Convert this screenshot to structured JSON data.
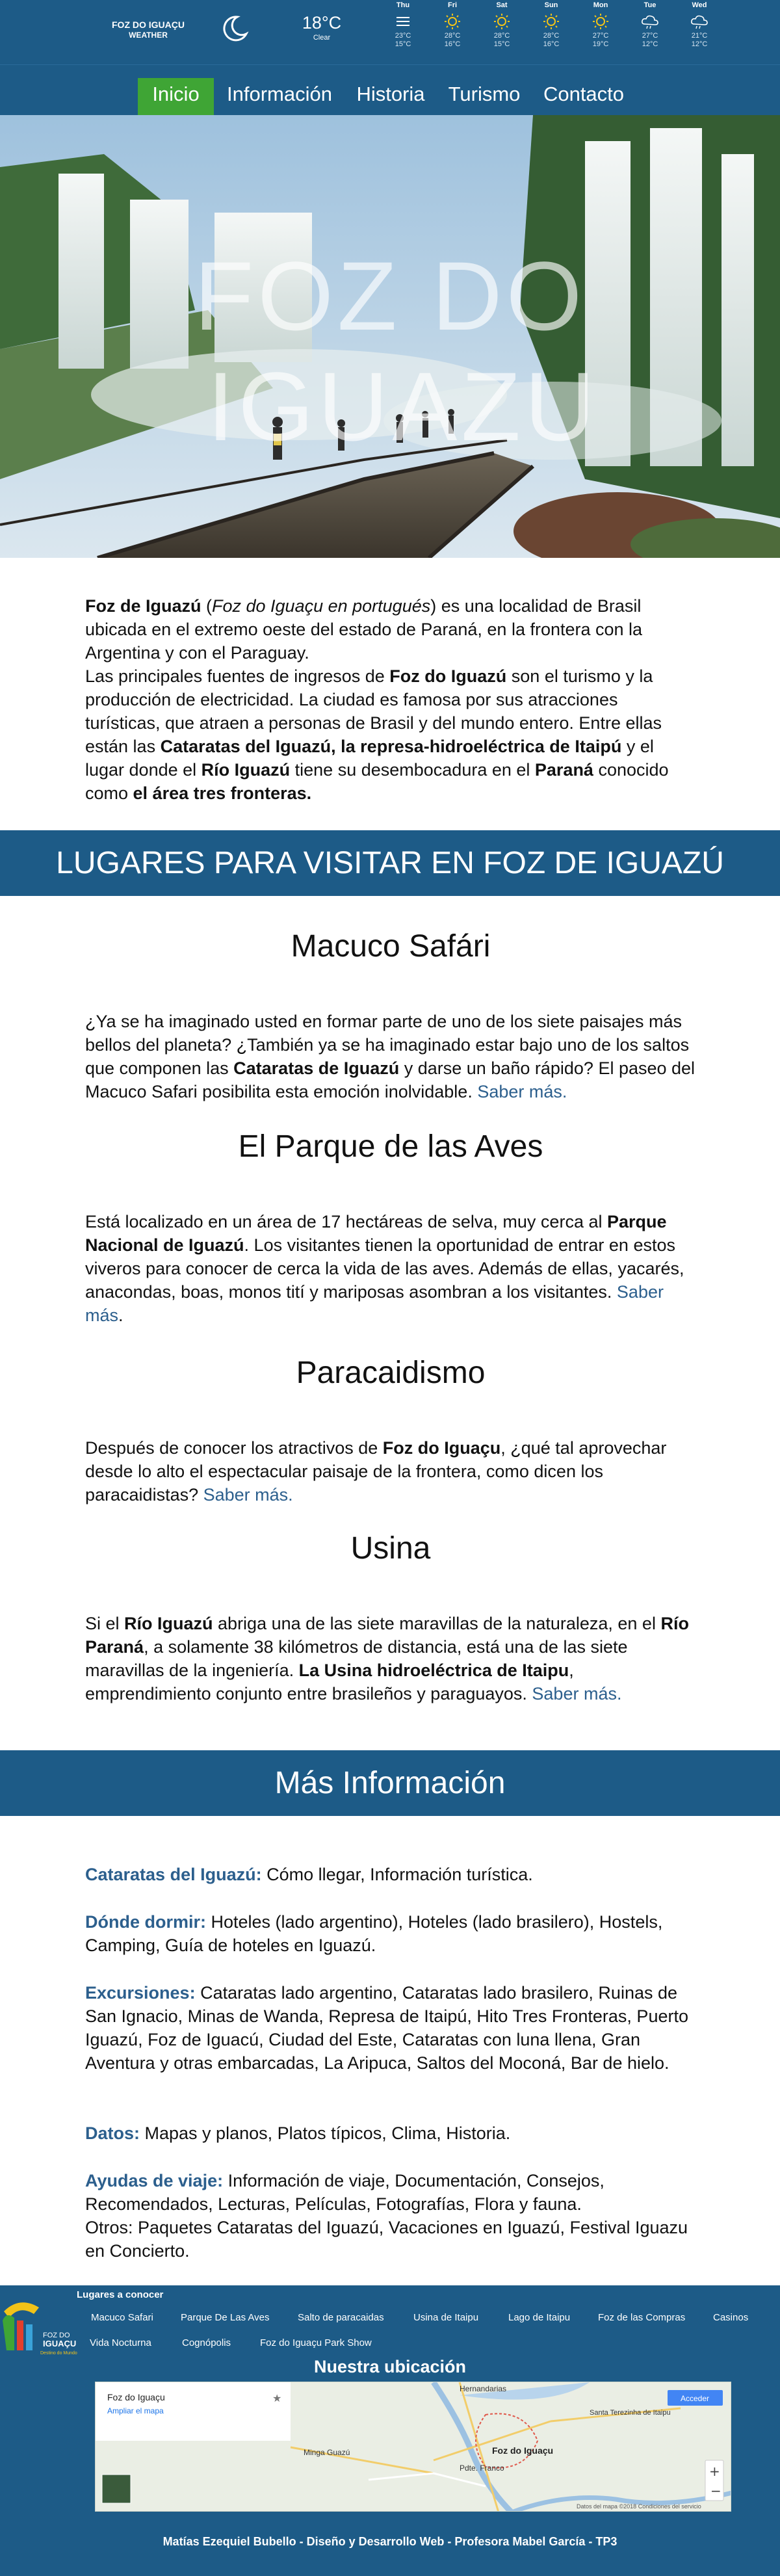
{
  "weather": {
    "location_line1": "FOZ DO IGUAÇU",
    "location_line2": "WEATHER",
    "icon": "moon-icon",
    "temp": "18°C",
    "condition": "Clear",
    "days": [
      {
        "name": "Thu",
        "icon": "menu-icon",
        "hi": "23°C",
        "lo": "15°C"
      },
      {
        "name": "Fri",
        "icon": "sun-icon",
        "hi": "28°C",
        "lo": "16°C"
      },
      {
        "name": "Sat",
        "icon": "sun-icon",
        "hi": "28°C",
        "lo": "15°C"
      },
      {
        "name": "Sun",
        "icon": "sun-icon",
        "hi": "28°C",
        "lo": "16°C"
      },
      {
        "name": "Mon",
        "icon": "sun-icon",
        "hi": "27°C",
        "lo": "19°C"
      },
      {
        "name": "Tue",
        "icon": "cloud-rain-icon",
        "hi": "27°C",
        "lo": "12°C"
      },
      {
        "name": "Wed",
        "icon": "cloud-rain-icon",
        "hi": "21°C",
        "lo": "12°C"
      }
    ]
  },
  "nav": {
    "items": [
      "Inicio",
      "Información",
      "Historia",
      "Turismo",
      "Contacto"
    ],
    "active": "Inicio",
    "active_color": "#3fa535",
    "bar_color": "#1d5b87"
  },
  "hero": {
    "title_line1": "FOZ DO",
    "title_line2": "IGUAZU"
  },
  "intro": {
    "p1_bold1": "Foz de Iguazú",
    "p1_text1": " (",
    "p1_italic": "Foz do Iguaçu en portugués",
    "p1_text2": ") es una localidad de Brasil ubicada en el extremo oeste del estado de Paraná, en la frontera con la Argentina y con el Paraguay.",
    "p2_text1": "Las principales fuentes de ingresos de ",
    "p2_bold1": "Foz do Iguazú",
    "p2_text2": " son el turismo y la producción de electricidad. La ciudad es famosa por sus atracciones turísticas, que atraen a personas de Brasil y del mundo entero. Entre ellas están las ",
    "p2_bold2": "Cataratas del Iguazú, la represa-hidroeléctrica de Itaipú",
    "p2_text3": " y el lugar donde el ",
    "p2_bold3": "Río Iguazú",
    "p2_text4": " tiene su desembocadura en el ",
    "p2_bold4": "Paraná",
    "p2_text5": " conocido como ",
    "p2_bold5": "el área tres fronteras."
  },
  "places_banner": "LUGARES PARA VISITAR EN FOZ DE IGUAZÚ",
  "places": [
    {
      "title": "Macuco Safári",
      "parts": [
        {
          "t": "¿Ya se ha imaginado usted en formar parte de uno de los siete paisajes más bellos del planeta? ¿También ya se ha imaginado estar bajo uno de los saltos que componen las "
        },
        {
          "b": "Cataratas de Iguazú"
        },
        {
          "t": " y darse un baño rápido? El paseo del Macuco Safari posibilita esta emoción inolvidable. "
        },
        {
          "a": "Saber más."
        }
      ]
    },
    {
      "title": "El Parque de las Aves",
      "parts": [
        {
          "t": "Está localizado en un área de 17 hectáreas de selva, muy cerca al "
        },
        {
          "b": "Parque Nacional de Iguazú"
        },
        {
          "t": ". Los visitantes tienen la oportunidad de entrar en estos viveros para conocer de cerca la vida de las aves. Además de ellas, yacarés, anacondas, boas, monos tití y mariposas asombran a los visitantes. "
        },
        {
          "a": "Saber más"
        },
        {
          "t": "."
        }
      ]
    },
    {
      "title": "Paracaidismo",
      "parts": [
        {
          "t": "Después de conocer los atractivos de "
        },
        {
          "b": "Foz do Iguaçu"
        },
        {
          "t": ", ¿qué tal aprovechar desde lo alto el espectacular paisaje de la frontera, como dicen los paracaidistas? "
        },
        {
          "a": "Saber más."
        }
      ]
    },
    {
      "title": "Usina",
      "parts": [
        {
          "t": "Si el "
        },
        {
          "b": "Río Iguazú"
        },
        {
          "t": " abriga una de las siete maravillas de la naturaleza, en el "
        },
        {
          "b": "Río Paraná"
        },
        {
          "t": ", a solamente 38 kilómetros de distancia, está una de las siete maravillas de la ingeniería. "
        },
        {
          "b": "La Usina hidroeléctrica de Itaipu"
        },
        {
          "t": ", emprendimiento conjunto entre brasileños y paraguayos. "
        },
        {
          "a": "Saber más."
        }
      ]
    }
  ],
  "more_banner": "Más Información",
  "more": [
    {
      "label": "Cataratas del Iguazú:",
      "text": " Cómo llegar, Información turística."
    },
    {
      "label": "Dónde dormir:",
      "text": " Hoteles (lado argentino), Hoteles (lado brasilero), Hostels, Camping, Guía de hoteles en Iguazú."
    },
    {
      "label": "Excursiones:",
      "text": " Cataratas lado argentino, Cataratas lado brasilero, Ruinas de San Ignacio, Minas de Wanda, Represa de Itaipú, Hito Tres Fronteras, Puerto Iguazú, Foz de Iguacú, Ciudad del Este, Cataratas con luna llena, Gran Aventura y otras embarcadas, La Aripuca, Saltos del Moconá, Bar de hielo."
    },
    {
      "label": "Datos:",
      "text": " Mapas y planos, Platos típicos, Clima, Historia."
    },
    {
      "label": "Ayudas de viaje:",
      "text": " Información de viaje, Documentación, Consejos, Recomendados, Lecturas, Películas, Fotografías, Flora y fauna."
    },
    {
      "label": "",
      "text": "Otros: Paquetes Cataratas del Iguazú, Vacaciones en Iguazú, Festival Iguazu en Concierto."
    }
  ],
  "footer": {
    "logo_text": "Foz do Iguaçu",
    "heading": "Lugares a conocer",
    "links_row1": [
      "Macuco Safari",
      "Parque De Las Aves",
      "Salto de paracaidas",
      "Usina de Itaipu",
      "Lago de Itaipu",
      "Foz de las Compras",
      "Casinos"
    ],
    "links_row2": [
      "Vida Nocturna",
      "Cognópolis",
      "Foz do Iguaçu Park Show"
    ],
    "location_title": "Nuestra ubicación",
    "map": {
      "place": "Foz do Iguaçu",
      "enlarge": "Ampliar el mapa",
      "sign_in": "Acceder",
      "labels": [
        "Hernandarias",
        "Santa Terezinha de Itaipu",
        "Foz do Iguaçu",
        "Minga Guazú",
        "Pdte. Franco"
      ],
      "attribution": "Datos del mapa ©2018   Condiciones del servicio"
    },
    "credit": "Matías Ezequiel Bubello - Diseño y Desarrollo Web - Profesora Mabel García - TP3"
  }
}
